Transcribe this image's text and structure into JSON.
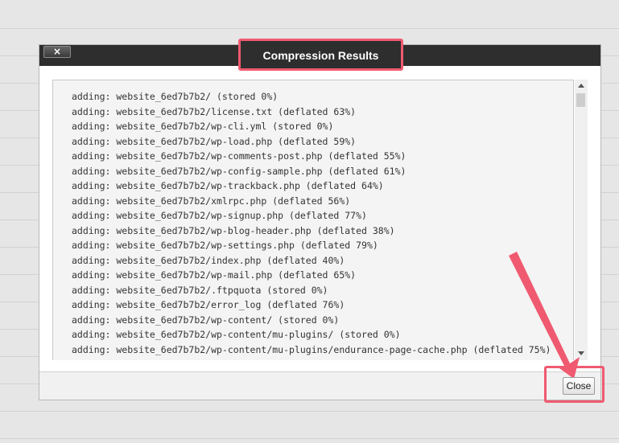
{
  "dialog": {
    "title": "Compression Results",
    "close_x_label": "×",
    "close_button_label": "Close",
    "log_lines": [
      "adding: website_6ed7b7b2/ (stored 0%)",
      "adding: website_6ed7b7b2/license.txt (deflated 63%)",
      "adding: website_6ed7b7b2/wp-cli.yml (stored 0%)",
      "adding: website_6ed7b7b2/wp-load.php (deflated 59%)",
      "adding: website_6ed7b7b2/wp-comments-post.php (deflated 55%)",
      "adding: website_6ed7b7b2/wp-config-sample.php (deflated 61%)",
      "adding: website_6ed7b7b2/wp-trackback.php (deflated 64%)",
      "adding: website_6ed7b7b2/xmlrpc.php (deflated 56%)",
      "adding: website_6ed7b7b2/wp-signup.php (deflated 77%)",
      "adding: website_6ed7b7b2/wp-blog-header.php (deflated 38%)",
      "adding: website_6ed7b7b2/wp-settings.php (deflated 79%)",
      "adding: website_6ed7b7b2/index.php (deflated 40%)",
      "adding: website_6ed7b7b2/wp-mail.php (deflated 65%)",
      "adding: website_6ed7b7b2/.ftpquota (stored 0%)",
      "adding: website_6ed7b7b2/error_log (deflated 76%)",
      "adding: website_6ed7b7b2/wp-content/ (stored 0%)",
      "adding: website_6ed7b7b2/wp-content/mu-plugins/ (stored 0%)",
      "adding: website_6ed7b7b2/wp-content/mu-plugins/endurance-page-cache.php (deflated 75%)"
    ]
  },
  "colors": {
    "highlight": "#f05a70",
    "titlebar": "#2e2e2e"
  }
}
